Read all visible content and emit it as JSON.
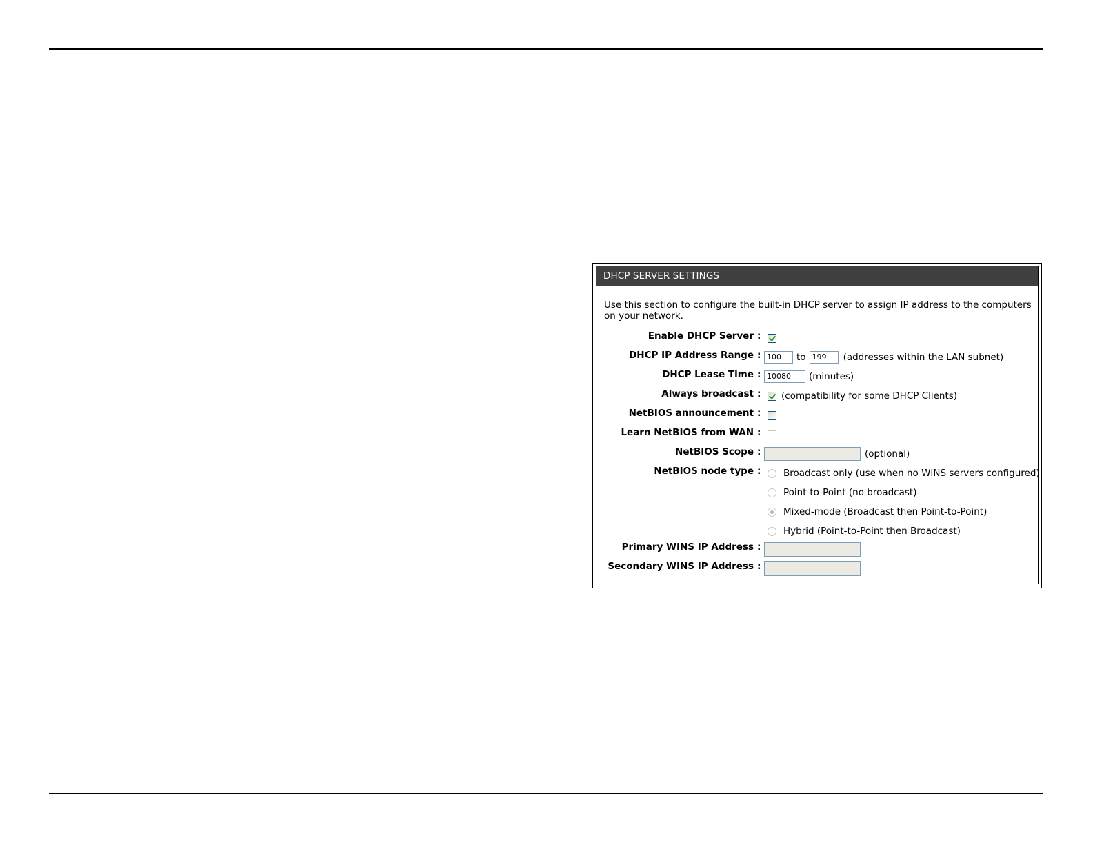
{
  "panel": {
    "title": "DHCP SERVER SETTINGS",
    "description": "Use this section to configure the built-in DHCP server to assign IP address to the computers on your network."
  },
  "fields": {
    "enable_dhcp": {
      "label": "Enable DHCP Server",
      "checked": true
    },
    "ip_range": {
      "label": "DHCP IP Address Range",
      "start": "100",
      "to": "to",
      "end": "199",
      "note": "(addresses within the LAN subnet)"
    },
    "lease_time": {
      "label": "DHCP Lease Time",
      "value": "10080",
      "note": "(minutes)"
    },
    "always_broadcast": {
      "label": "Always broadcast",
      "checked": true,
      "note": "(compatibility for some DHCP Clients)"
    },
    "netbios_announcement": {
      "label": "NetBIOS announcement",
      "checked": false
    },
    "learn_netbios": {
      "label": "Learn NetBIOS from WAN",
      "checked": false
    },
    "netbios_scope": {
      "label": "NetBIOS Scope",
      "value": "",
      "note": "(optional)"
    },
    "node_type": {
      "label": "NetBIOS node type",
      "options": [
        "Broadcast only (use when no WINS servers configured)",
        "Point-to-Point (no broadcast)",
        "Mixed-mode (Broadcast then Point-to-Point)",
        "Hybrid (Point-to-Point then Broadcast)"
      ],
      "selected": "Mixed-mode (Broadcast then Point-to-Point)"
    },
    "primary_wins": {
      "label": "Primary WINS IP Address",
      "value": ""
    },
    "secondary_wins": {
      "label": "Secondary WINS IP Address",
      "value": ""
    }
  },
  "colon": ":"
}
